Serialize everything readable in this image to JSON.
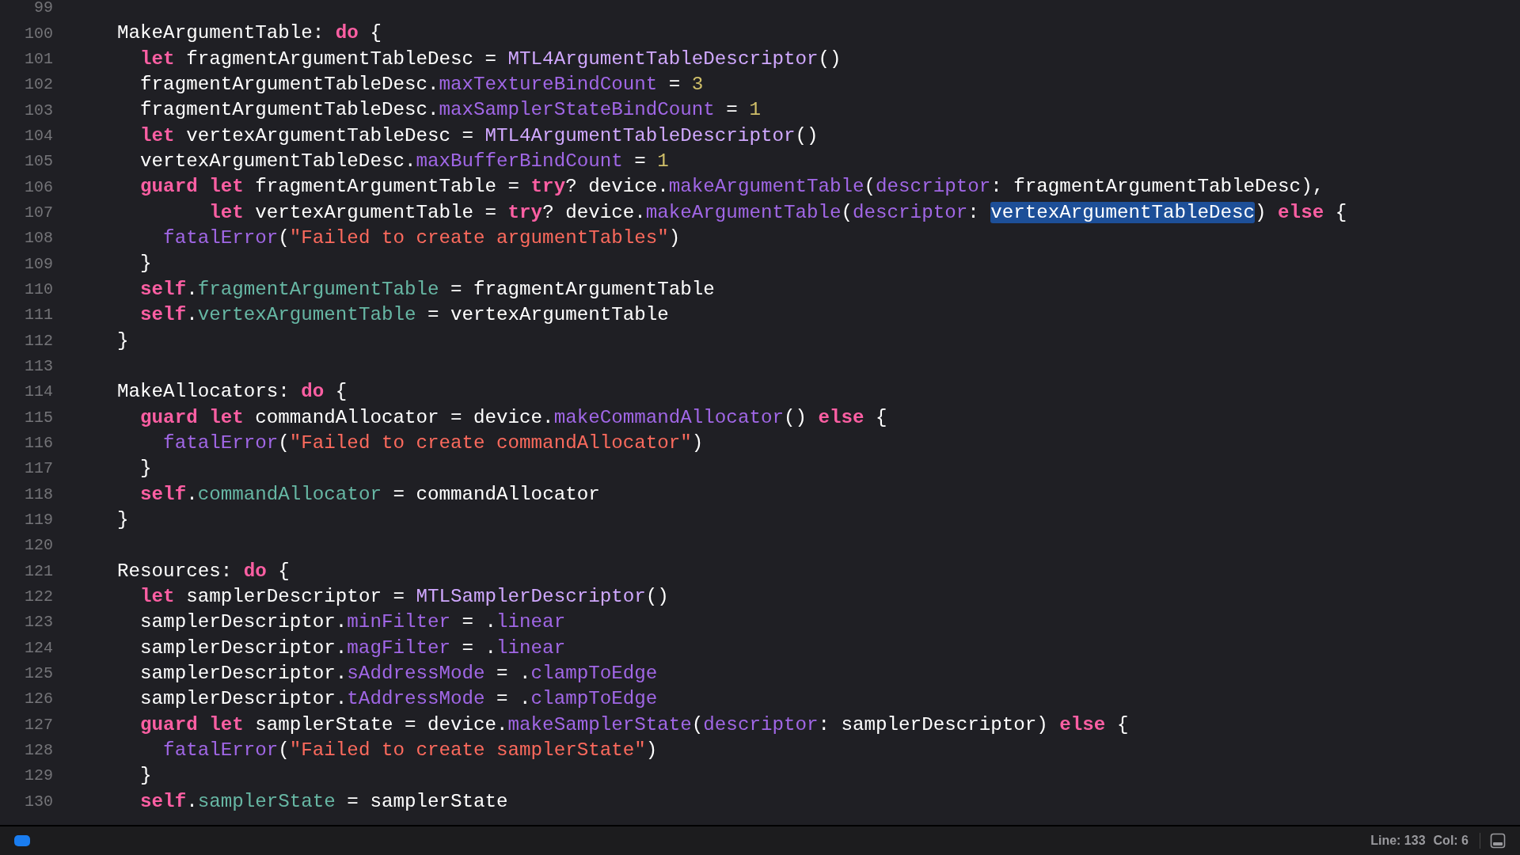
{
  "editor": {
    "lines": [
      {
        "number": "99"
      },
      {
        "number": "100",
        "tokens": [
          {
            "kind": "plain",
            "text": "    MakeArgumentTable: "
          },
          {
            "kind": "keyword",
            "text": "do"
          },
          {
            "kind": "plain",
            "text": " {"
          }
        ]
      },
      {
        "number": "101",
        "tokens": [
          {
            "kind": "keyword",
            "text": "      let"
          },
          {
            "kind": "plain",
            "text": " fragmentArgumentTableDesc = "
          },
          {
            "kind": "type",
            "text": "MTL4ArgumentTableDescriptor"
          },
          {
            "kind": "plain",
            "text": "()"
          }
        ]
      },
      {
        "number": "102",
        "tokens": [
          {
            "kind": "plain",
            "text": "      fragmentArgumentTableDesc."
          },
          {
            "kind": "member",
            "text": "maxTextureBindCount"
          },
          {
            "kind": "plain",
            "text": " = "
          },
          {
            "kind": "number",
            "text": "3"
          }
        ]
      },
      {
        "number": "103",
        "tokens": [
          {
            "kind": "plain",
            "text": "      fragmentArgumentTableDesc."
          },
          {
            "kind": "member",
            "text": "maxSamplerStateBindCount"
          },
          {
            "kind": "plain",
            "text": " = "
          },
          {
            "kind": "number",
            "text": "1"
          }
        ]
      },
      {
        "number": "104",
        "tokens": [
          {
            "kind": "keyword",
            "text": "      let"
          },
          {
            "kind": "plain",
            "text": " vertexArgumentTableDesc = "
          },
          {
            "kind": "type",
            "text": "MTL4ArgumentTableDescriptor"
          },
          {
            "kind": "plain",
            "text": "()"
          }
        ]
      },
      {
        "number": "105",
        "tokens": [
          {
            "kind": "plain",
            "text": "      vertexArgumentTableDesc."
          },
          {
            "kind": "member",
            "text": "maxBufferBindCount"
          },
          {
            "kind": "plain",
            "text": " = "
          },
          {
            "kind": "number",
            "text": "1"
          }
        ]
      },
      {
        "number": "106",
        "tokens": [
          {
            "kind": "keyword",
            "text": "      guard let"
          },
          {
            "kind": "plain",
            "text": " fragmentArgumentTable = "
          },
          {
            "kind": "keyword",
            "text": "try"
          },
          {
            "kind": "plain",
            "text": "? device."
          },
          {
            "kind": "member",
            "text": "makeArgumentTable"
          },
          {
            "kind": "plain",
            "text": "("
          },
          {
            "kind": "member",
            "text": "descriptor"
          },
          {
            "kind": "plain",
            "text": ": fragmentArgumentTableDesc),"
          }
        ]
      },
      {
        "number": "107",
        "tokens": [
          {
            "kind": "keyword",
            "text": "            let"
          },
          {
            "kind": "plain",
            "text": " vertexArgumentTable = "
          },
          {
            "kind": "keyword",
            "text": "try"
          },
          {
            "kind": "plain",
            "text": "? device."
          },
          {
            "kind": "member",
            "text": "makeArgumentTable"
          },
          {
            "kind": "plain",
            "text": "("
          },
          {
            "kind": "member",
            "text": "descriptor"
          },
          {
            "kind": "plain",
            "text": ": "
          },
          {
            "kind": "selection",
            "text": "vertexArgumentTableDesc"
          },
          {
            "kind": "plain",
            "text": ") "
          },
          {
            "kind": "keyword",
            "text": "else"
          },
          {
            "kind": "plain",
            "text": " {"
          }
        ]
      },
      {
        "number": "108",
        "tokens": [
          {
            "kind": "member",
            "text": "        fatalError"
          },
          {
            "kind": "plain",
            "text": "("
          },
          {
            "kind": "string",
            "text": "\"Failed to create argumentTables\""
          },
          {
            "kind": "plain",
            "text": ")"
          }
        ]
      },
      {
        "number": "109",
        "tokens": [
          {
            "kind": "plain",
            "text": "      }"
          }
        ]
      },
      {
        "number": "110",
        "tokens": [
          {
            "kind": "keyword",
            "text": "      self"
          },
          {
            "kind": "plain",
            "text": "."
          },
          {
            "kind": "property",
            "text": "fragmentArgumentTable"
          },
          {
            "kind": "plain",
            "text": " = fragmentArgumentTable"
          }
        ]
      },
      {
        "number": "111",
        "tokens": [
          {
            "kind": "keyword",
            "text": "      self"
          },
          {
            "kind": "plain",
            "text": "."
          },
          {
            "kind": "property",
            "text": "vertexArgumentTable"
          },
          {
            "kind": "plain",
            "text": " = vertexArgumentTable"
          }
        ]
      },
      {
        "number": "112",
        "tokens": [
          {
            "kind": "plain",
            "text": "    }"
          }
        ]
      },
      {
        "number": "113"
      },
      {
        "number": "114",
        "tokens": [
          {
            "kind": "plain",
            "text": "    MakeAllocators: "
          },
          {
            "kind": "keyword",
            "text": "do"
          },
          {
            "kind": "plain",
            "text": " {"
          }
        ]
      },
      {
        "number": "115",
        "tokens": [
          {
            "kind": "keyword",
            "text": "      guard let"
          },
          {
            "kind": "plain",
            "text": " commandAllocator = device."
          },
          {
            "kind": "member",
            "text": "makeCommandAllocator"
          },
          {
            "kind": "plain",
            "text": "() "
          },
          {
            "kind": "keyword",
            "text": "else"
          },
          {
            "kind": "plain",
            "text": " {"
          }
        ]
      },
      {
        "number": "116",
        "tokens": [
          {
            "kind": "member",
            "text": "        fatalError"
          },
          {
            "kind": "plain",
            "text": "("
          },
          {
            "kind": "string",
            "text": "\"Failed to create commandAllocator\""
          },
          {
            "kind": "plain",
            "text": ")"
          }
        ]
      },
      {
        "number": "117",
        "tokens": [
          {
            "kind": "plain",
            "text": "      }"
          }
        ]
      },
      {
        "number": "118",
        "tokens": [
          {
            "kind": "keyword",
            "text": "      self"
          },
          {
            "kind": "plain",
            "text": "."
          },
          {
            "kind": "property",
            "text": "commandAllocator"
          },
          {
            "kind": "plain",
            "text": " = commandAllocator"
          }
        ]
      },
      {
        "number": "119",
        "tokens": [
          {
            "kind": "plain",
            "text": "    }"
          }
        ]
      },
      {
        "number": "120"
      },
      {
        "number": "121",
        "tokens": [
          {
            "kind": "plain",
            "text": "    Resources: "
          },
          {
            "kind": "keyword",
            "text": "do"
          },
          {
            "kind": "plain",
            "text": " {"
          }
        ]
      },
      {
        "number": "122",
        "tokens": [
          {
            "kind": "keyword",
            "text": "      let"
          },
          {
            "kind": "plain",
            "text": " samplerDescriptor = "
          },
          {
            "kind": "type",
            "text": "MTLSamplerDescriptor"
          },
          {
            "kind": "plain",
            "text": "()"
          }
        ]
      },
      {
        "number": "123",
        "tokens": [
          {
            "kind": "plain",
            "text": "      samplerDescriptor."
          },
          {
            "kind": "member",
            "text": "minFilter"
          },
          {
            "kind": "plain",
            "text": " = ."
          },
          {
            "kind": "member",
            "text": "linear"
          }
        ]
      },
      {
        "number": "124",
        "tokens": [
          {
            "kind": "plain",
            "text": "      samplerDescriptor."
          },
          {
            "kind": "member",
            "text": "magFilter"
          },
          {
            "kind": "plain",
            "text": " = ."
          },
          {
            "kind": "member",
            "text": "linear"
          }
        ]
      },
      {
        "number": "125",
        "tokens": [
          {
            "kind": "plain",
            "text": "      samplerDescriptor."
          },
          {
            "kind": "member",
            "text": "sAddressMode"
          },
          {
            "kind": "plain",
            "text": " = ."
          },
          {
            "kind": "member",
            "text": "clampToEdge"
          }
        ]
      },
      {
        "number": "126",
        "tokens": [
          {
            "kind": "plain",
            "text": "      samplerDescriptor."
          },
          {
            "kind": "member",
            "text": "tAddressMode"
          },
          {
            "kind": "plain",
            "text": " = ."
          },
          {
            "kind": "member",
            "text": "clampToEdge"
          }
        ]
      },
      {
        "number": "127",
        "tokens": [
          {
            "kind": "keyword",
            "text": "      guard let"
          },
          {
            "kind": "plain",
            "text": " samplerState = device."
          },
          {
            "kind": "member",
            "text": "makeSamplerState"
          },
          {
            "kind": "plain",
            "text": "("
          },
          {
            "kind": "member",
            "text": "descriptor"
          },
          {
            "kind": "plain",
            "text": ": samplerDescriptor) "
          },
          {
            "kind": "keyword",
            "text": "else"
          },
          {
            "kind": "plain",
            "text": " {"
          }
        ]
      },
      {
        "number": "128",
        "tokens": [
          {
            "kind": "member",
            "text": "        fatalError"
          },
          {
            "kind": "plain",
            "text": "("
          },
          {
            "kind": "string",
            "text": "\"Failed to create samplerState\""
          },
          {
            "kind": "plain",
            "text": ")"
          }
        ]
      },
      {
        "number": "129",
        "tokens": [
          {
            "kind": "plain",
            "text": "      }"
          }
        ]
      },
      {
        "number": "130",
        "tokens": [
          {
            "kind": "keyword",
            "text": "      self"
          },
          {
            "kind": "plain",
            "text": "."
          },
          {
            "kind": "property",
            "text": "samplerState"
          },
          {
            "kind": "plain",
            "text": " = samplerState"
          }
        ]
      }
    ]
  },
  "status_bar": {
    "line": "Line: 133",
    "column": "Col: 6"
  }
}
